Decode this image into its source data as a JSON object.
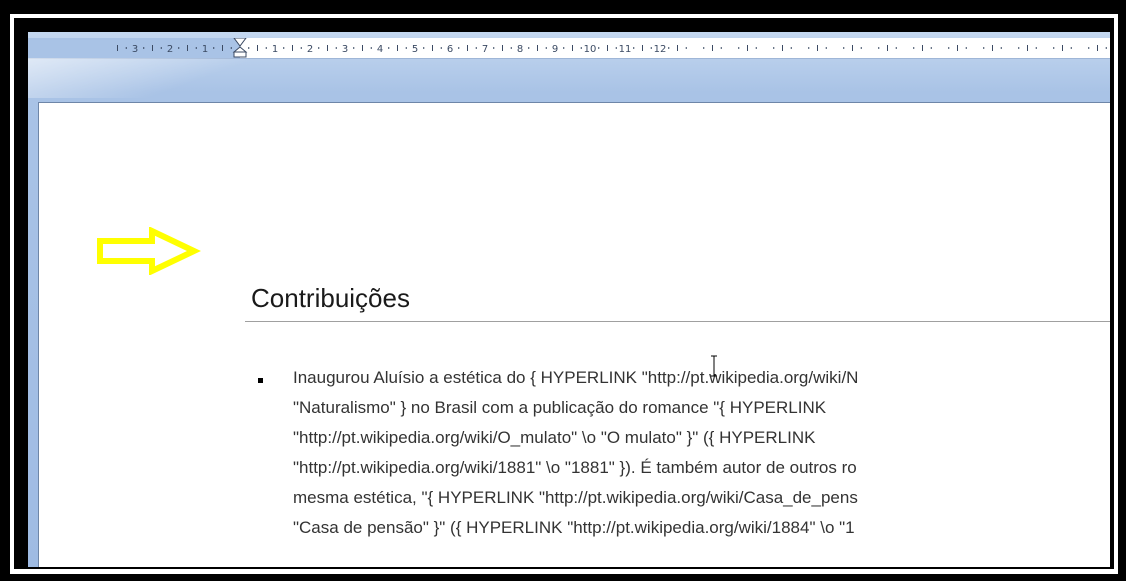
{
  "ruler": {
    "labels": [
      "3",
      "2",
      "1",
      "1",
      "2",
      "3",
      "4",
      "5",
      "6",
      "7",
      "8",
      "9",
      "10",
      "11",
      "12"
    ]
  },
  "document": {
    "heading": "Contribuições",
    "paragraph_lines": [
      "Inaugurou Aluísio a estética do { HYPERLINK  \"http://pt.wikipedia.org/wiki/N",
      "\"Naturalismo\" } no Brasil com a publicação do romance \"{ HYPERLINK",
      "\"http://pt.wikipedia.org/wiki/O_mulato\" \\o \"O mulato\" }\" ({ HYPERLINK",
      "\"http://pt.wikipedia.org/wiki/1881\" \\o \"1881\" }). É também autor de outros ro",
      "mesma estética, \"{ HYPERLINK  \"http://pt.wikipedia.org/wiki/Casa_de_pens",
      "\"Casa de pensão\" }\" ({ HYPERLINK  \"http://pt.wikipedia.org/wiki/1884\" \\o \"1"
    ]
  },
  "colors": {
    "arrow": "#ffff00",
    "page_background": "#ffffff",
    "workspace": "#a9c3e6"
  },
  "icons": {
    "annotation": "yellow-arrow-icon",
    "cursor": "text-cursor-icon"
  }
}
